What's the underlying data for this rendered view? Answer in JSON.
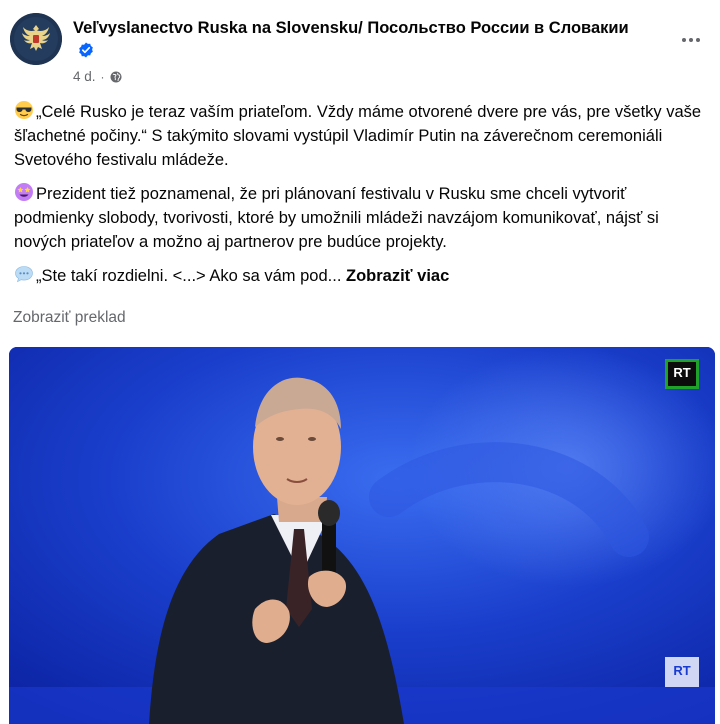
{
  "post": {
    "author": "Veľvyslanectvo Ruska na Slovensku/ Посольство России в Словакии",
    "time": "4 d.",
    "dot": "·",
    "paragraphs": [
      {
        "emoji": "sunglasses-emoji",
        "text": "„Celé Rusko je teraz vaším priateľom. Vždy máme otvorené dvere pre vás, pre všetky vaše šľachetné počiny.“ S takýmito slovami vystúpil Vladimír Putin na záverečnom ceremoniáli Svetového festivalu mládeže."
      },
      {
        "emoji": "star-struck-emoji",
        "text": "Prezident tiež poznamenal, že pri plánovaní festivalu v Rusku sme chceli vytvoriť podmienky slobody, tvorivosti, ktoré by umožnili mládeži navzájom komunikovať, nájsť si nových priateľov a možno aj partnerov pre budúce projekty."
      },
      {
        "emoji": "speech-bubble-emoji",
        "text": "„Ste takí rozdielni. <...> Ako sa vám pod...",
        "see_more": "Zobraziť viac"
      }
    ],
    "translate": "Zobraziť preklad",
    "media": {
      "watermark_top": "RT",
      "watermark_bottom": "RT"
    }
  },
  "colors": {
    "text": "#050505",
    "secondary": "#65676b",
    "verified": "#0866ff",
    "media_bg": "#1232b8"
  }
}
